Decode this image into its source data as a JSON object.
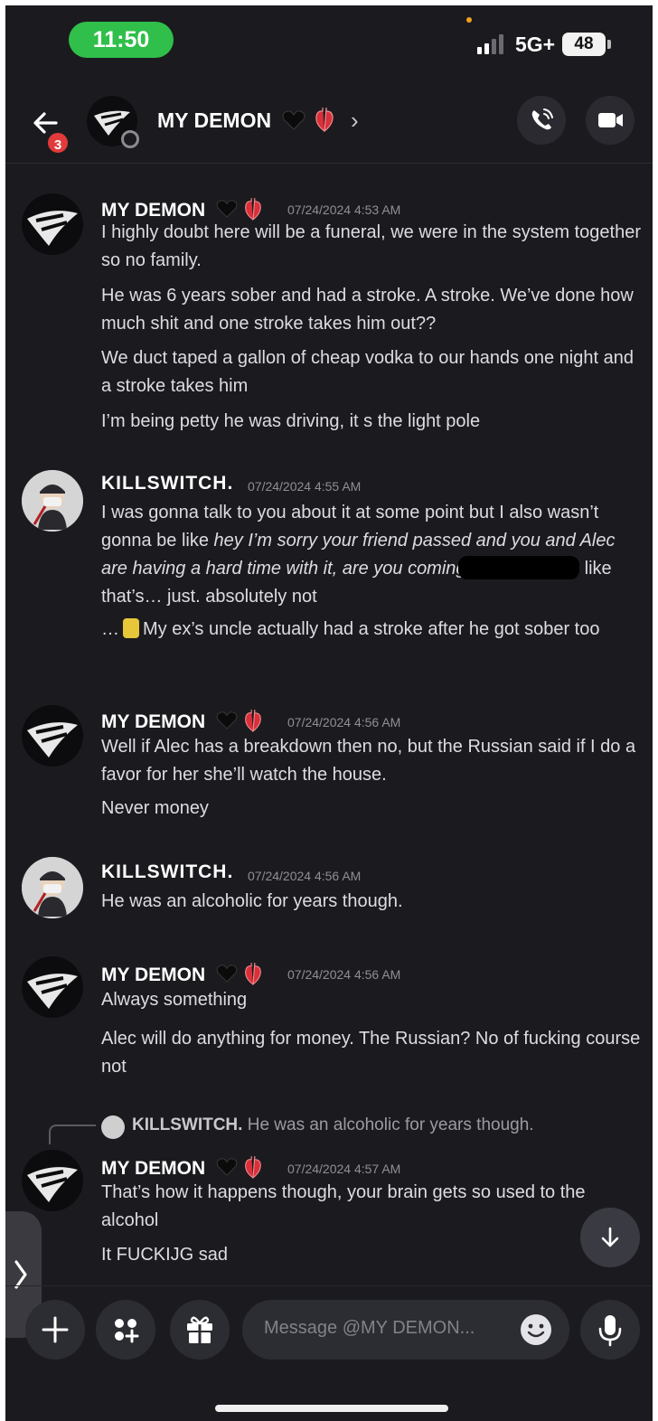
{
  "status_bar": {
    "time": "11:50",
    "network": "5G+",
    "battery": "48"
  },
  "header": {
    "back_badge": "3",
    "title": "MY DEMON",
    "chevron": "›"
  },
  "messages": [
    {
      "author": "MY DEMON",
      "timestamp": "07/24/2024 4:53 AM",
      "lines": [
        "I highly doubt here will be a funeral, we were in the system together so no family.",
        "He was 6 years sober and had a stroke. A stroke. We’ve done how much shit and one stroke takes him out??",
        "We duct taped a gallon of cheap vodka to our hands one night and a stroke takes him",
        "I’m being petty he was driving, it s the light pole"
      ]
    },
    {
      "author": "KILLSWITCH.",
      "timestamp": "07/24/2024 4:55 AM",
      "lines": [
        "I was gonna talk to you about it at some point but I also wasn’t gonna be like",
        "hey I’m sorry your friend passed and you and Alec are having a hard time with it, are you coming",
        "like that’s… just. absolutely not",
        "…",
        "My ex’s uncle actually had a stroke after he got sober too"
      ]
    },
    {
      "author": "MY DEMON",
      "timestamp": "07/24/2024 4:56 AM",
      "lines": [
        "Well if Alec has a breakdown then no, but the Russian said if I do a favor for her she’ll watch the house.",
        "Never money"
      ]
    },
    {
      "author": "KILLSWITCH.",
      "timestamp": "07/24/2024 4:56 AM",
      "lines": [
        "He was an alcoholic for years though."
      ]
    },
    {
      "author": "MY DEMON",
      "timestamp": "07/24/2024 4:56 AM",
      "lines": [
        "Always something",
        "Alec will do anything for money. The Russian? No of fucking course not"
      ]
    },
    {
      "reply_to": {
        "author": "KILLSWITCH.",
        "text": "He was an alcoholic for years though."
      },
      "author": "MY DEMON",
      "timestamp": "07/24/2024 4:57 AM",
      "lines": [
        "That’s how it happens though, your brain gets so used to the alcohol",
        "It FUCKIJG sad"
      ]
    }
  ],
  "composer": {
    "placeholder": "Message @MY DEMON..."
  },
  "icons": [
    "back-arrow-icon",
    "call-icon",
    "video-icon",
    "plus-icon",
    "apps-icon",
    "gift-icon",
    "emoji-icon",
    "mic-icon",
    "scroll-down-icon",
    "side-chevron-icon"
  ],
  "colors": {
    "background": "#1b1b1f",
    "badge": "#e23b3b",
    "time_pill": "#2fbf4a",
    "heart_red": "#d9303a"
  }
}
